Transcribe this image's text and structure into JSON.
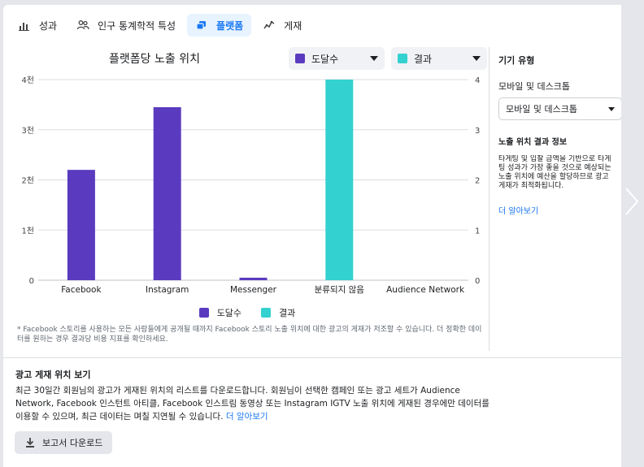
{
  "tabs": [
    {
      "label": "성과",
      "icon": "bar-chart-icon"
    },
    {
      "label": "인구 통계학적 특성",
      "icon": "people-icon"
    },
    {
      "label": "플랫폼",
      "icon": "platform-icon"
    },
    {
      "label": "게재",
      "icon": "line-chart-icon"
    }
  ],
  "selectors": {
    "left": {
      "label": "도달수",
      "color": "#5a3bbf"
    },
    "right": {
      "label": "결과",
      "color": "#33d1cf"
    }
  },
  "right_panel": {
    "device_heading": "기기 유형",
    "device_label": "모바일 및 데스크톱",
    "device_value": "모바일 및 데스크톱",
    "info_heading": "노출 위치 결과 정보",
    "info_lines": [
      "타게팅 및 입찰 금액을 기반으로 타게",
      "팅 성과가 가장 좋을 것으로 예상되는",
      "노출 위치에 예산을 할당하므로 광고",
      "게재가 최적화됩니다."
    ],
    "learn_more": "더 알아보기"
  },
  "legend": [
    {
      "label": "도달수",
      "color": "#5a3bbf"
    },
    {
      "label": "결과",
      "color": "#33d1cf"
    }
  ],
  "note": "* Facebook 스토리를 사용하는 모든 사람들에게 공개될 때까지 Facebook 스토리 노출 위치에 대한 광고의 게재가 저조할 수 있습니다. 더 정확한 데이터를 원하는 경우 결과당 비용 지표를 확인하세요.",
  "report": {
    "title": "광고 게재 위치 보기",
    "text": "최근 30일간 회원님의 광고가 게재된 위치의 리스트를 다운로드합니다. 회원님이 선택한 캠페인 또는 광고 세트가 Audience Network, Facebook 인스턴트 아티클, Facebook 인스트림 동영상 또는 Instagram IGTV 노출 위치에 게재된 경우에만 데이터를 이용할 수 있으며, 최근 데이터는 며칠 지연될 수 있습니다.",
    "learn_more": "더 알아보기",
    "download_label": "보고서 다운로드"
  },
  "chart_data": {
    "type": "bar",
    "title": "플랫폼당 노출 위치",
    "categories": [
      "Facebook",
      "Instagram",
      "Messenger",
      "분류되지 않음",
      "Audience Network"
    ],
    "series": [
      {
        "name": "도달수",
        "values": [
          2200,
          3450,
          50,
          0,
          0
        ],
        "color": "#5a3bbf",
        "axis": "left"
      },
      {
        "name": "결과",
        "values": [
          0,
          0,
          0,
          4,
          0
        ],
        "color": "#33d1cf",
        "axis": "right"
      }
    ],
    "left_axis": {
      "ticks": [
        "0",
        "1천",
        "2천",
        "3천",
        "4천"
      ],
      "ylim": [
        0,
        4000
      ]
    },
    "right_axis": {
      "ticks": [
        "0",
        "1",
        "2",
        "3",
        "4"
      ],
      "ylim": [
        0,
        4
      ]
    },
    "grid": true,
    "legend_position": "bottom"
  }
}
